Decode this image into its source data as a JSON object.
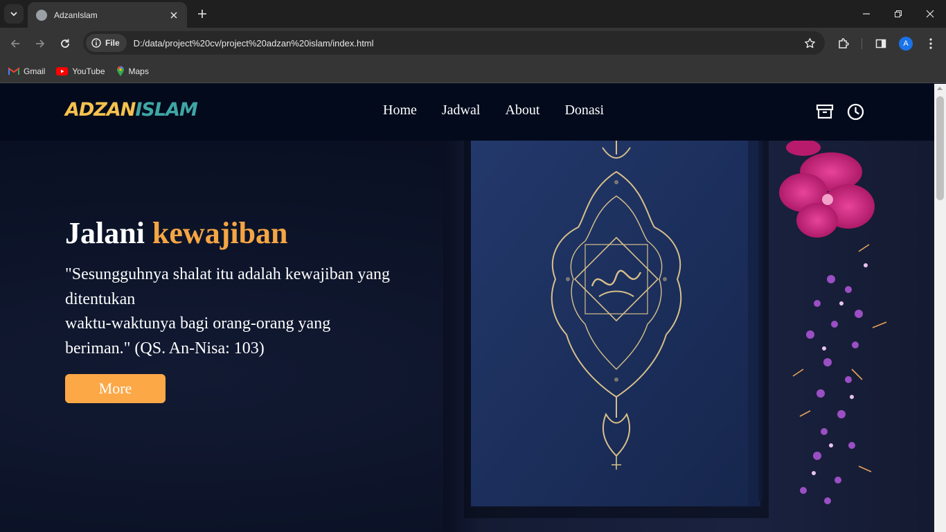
{
  "browser": {
    "tab_title": "AdzanIslam",
    "site_chip_label": "File",
    "url": "D:/data/project%20cv/project%20adzan%20islam/index.html",
    "profile_initial": "A",
    "bookmarks": [
      {
        "label": "Gmail",
        "icon": "gmail-icon",
        "color": "#ea4335"
      },
      {
        "label": "YouTube",
        "icon": "youtube-icon",
        "color": "#ff0000"
      },
      {
        "label": "Maps",
        "icon": "maps-icon",
        "color": "#34a853"
      }
    ]
  },
  "site": {
    "logo_part1": "ADZAN",
    "logo_part2": "ISLAM",
    "nav": [
      "Home",
      "Jadwal",
      "About",
      "Donasi"
    ],
    "icons": [
      "archive-icon",
      "clock-icon"
    ]
  },
  "hero": {
    "title_main": "Jalani",
    "title_accent": "kewajiban",
    "quote": "\"Sesungguhnya shalat itu adalah kewajiban yang ditentukan\nwaktu-waktunya bagi orang-orang yang beriman.\" (QS. An-Nisa: 103)",
    "button_label": "More",
    "image_subject": "quran-book-with-flowers"
  },
  "colors": {
    "accent_orange": "#f5a544",
    "button_orange": "#fca847",
    "logo_yellow": "#f6c24e",
    "logo_teal": "#3fa6a4",
    "nav_bg": "#020a1c",
    "book_blue": "#1f3566",
    "ornament_gold": "#d8c08a",
    "flower_magenta": "#c8207a",
    "flower_purple": "#9b4fc4"
  }
}
